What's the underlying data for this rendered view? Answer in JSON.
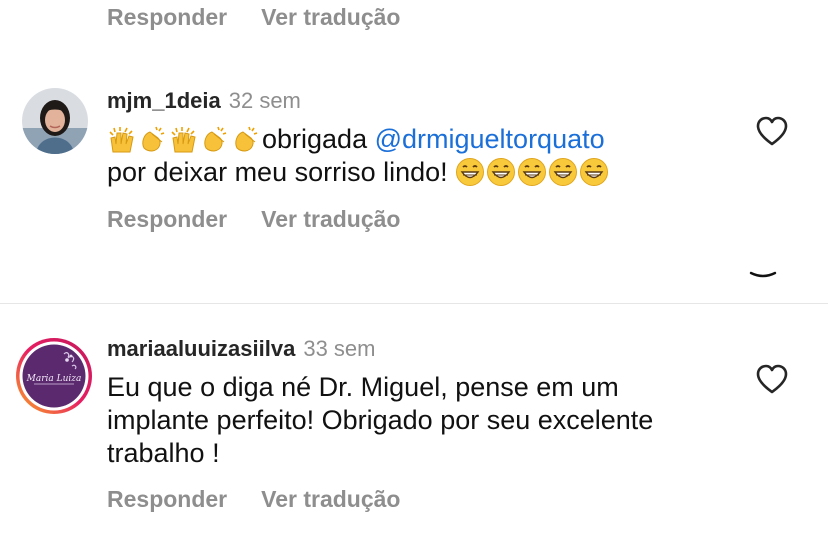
{
  "top_actions": {
    "reply": "Responder",
    "translate": "Ver tradução"
  },
  "comments": [
    {
      "username": "mjm_1deia",
      "time": "32 sem",
      "emoji_prefix": [
        "raising-hands",
        "clapping-hands",
        "raising-hands",
        "clapping-hands",
        "clapping-hands"
      ],
      "text_before_mention": "obrigada ",
      "mention": "@drmigueltorquato",
      "text_after_mention": "por deixar meu sorriso lindo! ",
      "emoji_suffix": [
        "grinning-face",
        "grinning-face",
        "grinning-face",
        "grinning-face",
        "grinning-face"
      ],
      "reply": "Responder",
      "translate": "Ver tradução"
    },
    {
      "username": "mariaaluuizasiilva",
      "time": "33 sem",
      "text_lines": [
        "Eu que o diga né Dr. Miguel, pense em um",
        "implante perfeito! Obrigado por seu excelente",
        "trabalho !"
      ],
      "avatar_text": "Maria Luiza",
      "reply": "Responder",
      "translate": "Ver tradução"
    }
  ],
  "colors": {
    "meta_gray": "#8e8e8e",
    "mention_blue": "#1b6fd8",
    "divider": "#e6e6e6",
    "avatar_purple": "#5b2a6e",
    "story_ring_start": "#f9a825",
    "story_ring_end": "#c2185b"
  }
}
